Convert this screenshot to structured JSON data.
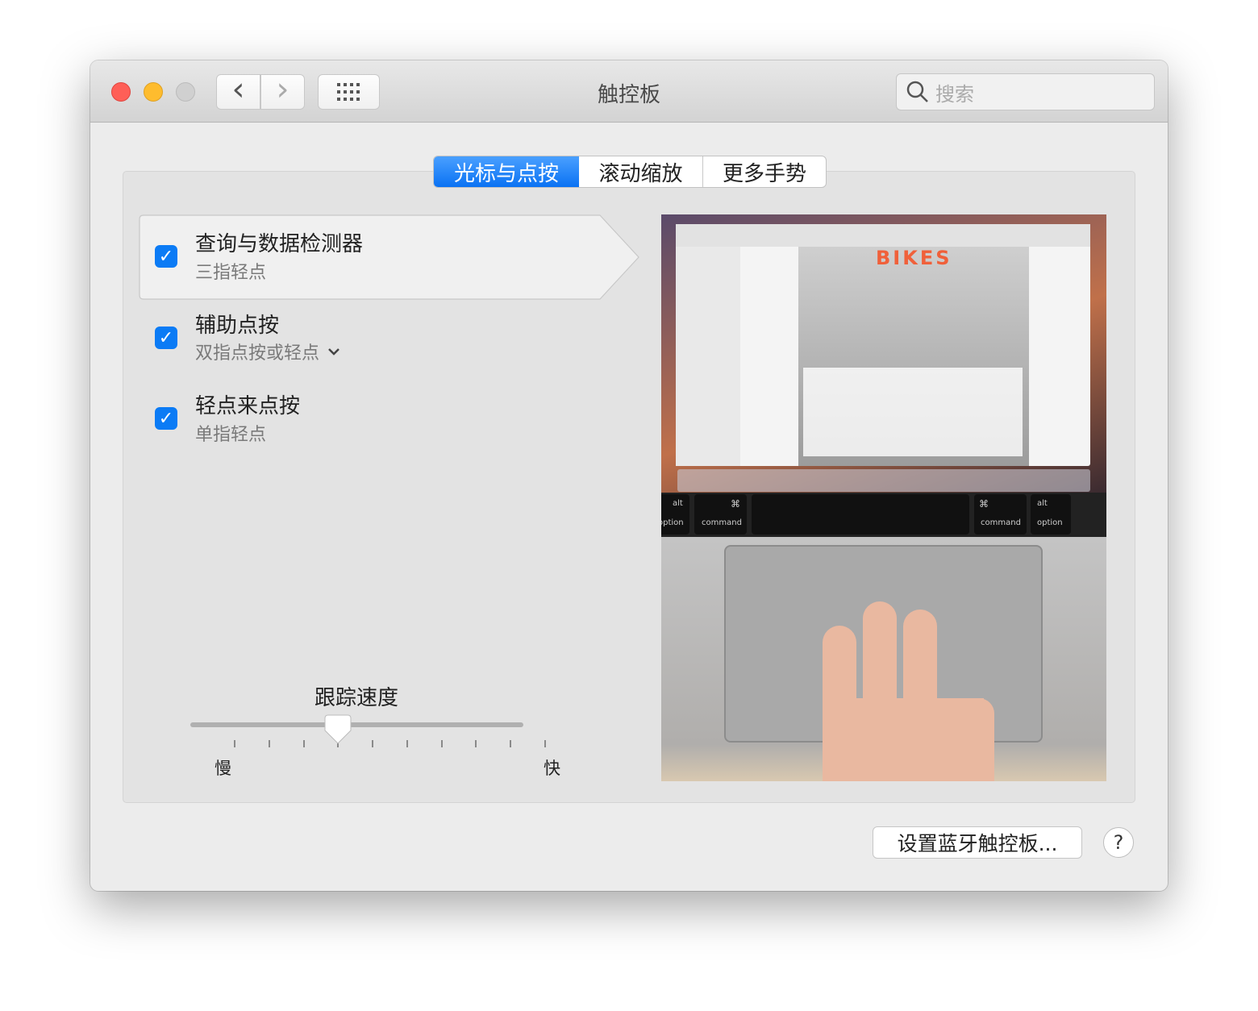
{
  "window": {
    "title": "触控板",
    "search_placeholder": "搜索",
    "nav": {
      "back": "‹",
      "forward": "›"
    }
  },
  "tabs": [
    {
      "label": "光标与点按",
      "active": true
    },
    {
      "label": "滚动缩放",
      "active": false
    },
    {
      "label": "更多手势",
      "active": false
    }
  ],
  "items": [
    {
      "title": "查询与数据检测器",
      "subtitle": "三指轻点",
      "checked": true,
      "selected": true
    },
    {
      "title": "辅助点按",
      "subtitle": "双指点按或轻点",
      "checked": true,
      "has_dropdown": true
    },
    {
      "title": "轻点来点按",
      "subtitle": "单指轻点",
      "checked": true
    }
  ],
  "tracking_speed": {
    "label": "跟踪速度",
    "min_label": "慢",
    "max_label": "快",
    "ticks": 10,
    "value_fraction": 0.333
  },
  "preview": {
    "doc_title": "BIKES",
    "keys": {
      "alt": "alt",
      "option": "option",
      "command": "command",
      "cmd_symbol": "⌘"
    }
  },
  "footer": {
    "bluetooth_button": "设置蓝牙触控板...",
    "help": "?"
  },
  "colors": {
    "accent": "#0b7bf5",
    "close": "#fe5f57",
    "minimize": "#febc2e",
    "zoom": "#d0d0d0"
  }
}
